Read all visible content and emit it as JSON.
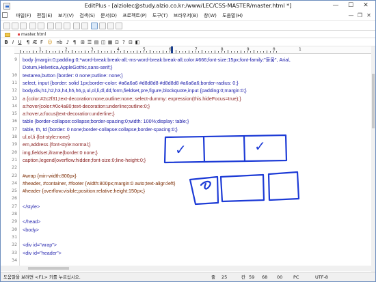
{
  "window": {
    "title": "EditPlus - [alziolec@study.alzio.co.kr:/www/LEC/CSS-MASTER/master.html *]",
    "controls": [
      "—",
      "☐",
      "✕"
    ]
  },
  "menu": [
    "파일(F)",
    "편집(E)",
    "보기(V)",
    "검색(S)",
    "문서(D)",
    "프로젝트(P)",
    "도구(T)",
    "브라우저(B)",
    "창(W)",
    "도움말(H)"
  ],
  "menu_doc_controls": [
    "—",
    "❐",
    "✕"
  ],
  "file_tab": "master.html",
  "format_toolbar": [
    "B",
    "I",
    "U",
    "¶",
    "Æ",
    "F",
    "☺",
    "nb",
    "♪",
    "¶",
    "⊞",
    "☰",
    "▤",
    "◫",
    "▦",
    "⊡",
    "?",
    "⊟",
    "◧"
  ],
  "ruler": {
    "labels": [
      "1",
      "2",
      "3",
      "4",
      "5",
      "6",
      "7",
      "8",
      "9",
      "0",
      "1"
    ]
  },
  "editor": {
    "lines": [
      {
        "n": "9",
        "text": "body {margin:0;padding:0;*word-break:break-all;-ms-word-break:break-all;color:#666;font-size:15px;font-family:\"돋움\", Arial,"
      },
      {
        "n": "",
        "text": "Dotum,Helvetica,AppleGothic,sans-serif;}"
      },
      {
        "n": "10",
        "text": "textarea,button {border: 0 none;outline: none;}"
      },
      {
        "n": "11",
        "text": "select, input {border: solid 1px;border-color: #a6a6a6 #d8d8d8 #d8d8d8 #a6a6a6;border-radius: 0;}"
      },
      {
        "n": "12",
        "text": "body,div,h1,h2,h3,h4,h5,h6,p,ul,ol,li,dl,dd,form,fieldset,pre,figure,blockquote,input {padding:0;margin:0;}"
      },
      {
        "n": "13",
        "text": "a {color:#2c2f31;text-decoration:none;outline:none; select-dummy: expression(this.hideFocus=true);}"
      },
      {
        "n": "14",
        "text": "a:hover{color:#0c4a80;text-decoration:underline;outline:0;}"
      },
      {
        "n": "15",
        "text": "a:hover,a:focus{text-decoration:underline;}"
      },
      {
        "n": "16",
        "text": "table {border-collapse:collapse;border-spacing:0;width: 100%;display: table;}"
      },
      {
        "n": "17",
        "text": "table, th, td {border: 0 none;border-collapse:collapse;border-spacing:0;}"
      },
      {
        "n": "18",
        "text": "ul,ol,li {list-style:none}"
      },
      {
        "n": "19",
        "text": "em,address {font-style:normal;}"
      },
      {
        "n": "20",
        "text": "img,fieldset,iframe{border:0 none;}"
      },
      {
        "n": "21",
        "text": "caption,legend{overflow:hidden;font-size:0;line-height:0;}"
      },
      {
        "n": "22",
        "text": ""
      },
      {
        "n": "23",
        "text": "#wrap {min-width:800px}"
      },
      {
        "n": "24",
        "text": "#header, #container, #footer {width:800px;margin:0 auto;text-align:left}"
      },
      {
        "n": "25",
        "text": "#header {overflow:visible;position:relative;height:150px;}"
      },
      {
        "n": "26",
        "text": ""
      },
      {
        "n": "27",
        "text": "</style>"
      },
      {
        "n": "28",
        "text": ""
      },
      {
        "n": "29",
        "text": "</head>"
      },
      {
        "n": "30",
        "text": "<body>"
      },
      {
        "n": "31",
        "text": ""
      },
      {
        "n": "32",
        "text": "<div id=\"wrap\">"
      },
      {
        "n": "33",
        "text": "<div id=\"header\">"
      },
      {
        "n": "34",
        "text": ""
      }
    ]
  },
  "statusbar": {
    "hint": "도움말을 보려면 <F1> 키를 누르십시오.",
    "ln_label": "줄",
    "ln": "25",
    "col_label": "칸",
    "col": "59",
    "chars": "68",
    "flag1": "00",
    "mode": "PC",
    "encoding": "UTF-8"
  },
  "annotations": {
    "checks": [
      "✓",
      "✓"
    ]
  },
  "colors": {
    "ink": "#1d3bd6",
    "code_text": "#1a1aa8",
    "attr_text": "#8a1f1f",
    "tag_text": "#2a2ab0",
    "string_text": "#c2185b",
    "selector_text": "#7a2a00"
  }
}
